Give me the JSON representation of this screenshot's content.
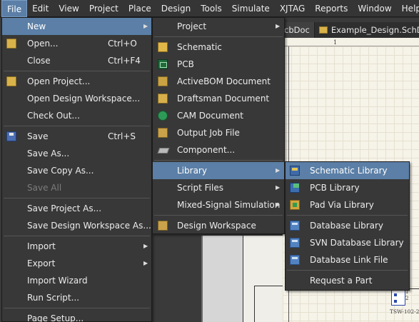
{
  "menubar": {
    "items": [
      {
        "label": "File",
        "underline": "F"
      },
      {
        "label": "Edit",
        "underline": "E"
      },
      {
        "label": "View",
        "underline": "V"
      },
      {
        "label": "Project",
        "underline": "c"
      },
      {
        "label": "Place",
        "underline": "P"
      },
      {
        "label": "Design",
        "underline": "D"
      },
      {
        "label": "Tools",
        "underline": "T"
      },
      {
        "label": "Simulate",
        "underline": "S"
      },
      {
        "label": "XJTAG",
        "underline": "J"
      },
      {
        "label": "Reports",
        "underline": "R"
      },
      {
        "label": "Window",
        "underline": "W"
      },
      {
        "label": "Help",
        "underline": "H"
      }
    ],
    "active": "File"
  },
  "doc_tabs": [
    {
      "label": "cbDoc"
    },
    {
      "label": "Example_Design.SchDoc"
    }
  ],
  "schematic": {
    "ruler_label": "1",
    "component_pins": [
      "1",
      "2"
    ],
    "component_label": "TSW-102-2"
  },
  "file_menu": {
    "items": [
      {
        "label": "New",
        "has_submenu": true,
        "highlighted": true
      },
      {
        "label": "Open...",
        "shortcut": "Ctrl+O",
        "icon": "open-folder-icon"
      },
      {
        "label": "Close",
        "shortcut": "Ctrl+F4"
      },
      {
        "label": "Open Project...",
        "icon": "open-project-icon"
      },
      {
        "label": "Open Design Workspace..."
      },
      {
        "label": "Check Out..."
      },
      {
        "label": "Save",
        "shortcut": "Ctrl+S",
        "icon": "save-icon"
      },
      {
        "label": "Save As..."
      },
      {
        "label": "Save Copy As..."
      },
      {
        "label": "Save All",
        "disabled": true
      },
      {
        "label": "Save Project As..."
      },
      {
        "label": "Save Design Workspace As..."
      },
      {
        "label": "Import",
        "has_submenu": true
      },
      {
        "label": "Export",
        "has_submenu": true
      },
      {
        "label": "Import Wizard"
      },
      {
        "label": "Run Script..."
      },
      {
        "label": "Page Setup..."
      }
    ]
  },
  "new_menu": {
    "items": [
      {
        "label": "Project",
        "has_submenu": true
      },
      {
        "label": "Schematic",
        "icon": "schematic-icon"
      },
      {
        "label": "PCB",
        "icon": "pcb-icon"
      },
      {
        "label": "ActiveBOM Document",
        "icon": "activebom-icon"
      },
      {
        "label": "Draftsman Document",
        "icon": "draftsman-icon"
      },
      {
        "label": "CAM Document",
        "icon": "cam-icon"
      },
      {
        "label": "Output Job File",
        "icon": "output-job-icon"
      },
      {
        "label": "Component...",
        "icon": "component-icon"
      },
      {
        "label": "Library",
        "has_submenu": true,
        "highlighted": true
      },
      {
        "label": "Script Files",
        "has_submenu": true
      },
      {
        "label": "Mixed-Signal Simulation",
        "has_submenu": true
      },
      {
        "label": "Design Workspace",
        "icon": "design-workspace-icon"
      }
    ]
  },
  "library_menu": {
    "items": [
      {
        "label": "Schematic Library",
        "icon": "schematic-library-icon",
        "highlighted": true
      },
      {
        "label": "PCB Library",
        "icon": "pcb-library-icon"
      },
      {
        "label": "Pad Via Library",
        "icon": "pad-via-library-icon"
      },
      {
        "label": "Database Library",
        "icon": "database-library-icon"
      },
      {
        "label": "SVN Database Library",
        "icon": "svn-database-library-icon"
      },
      {
        "label": "Database Link File",
        "icon": "database-link-icon"
      },
      {
        "label": "Request a Part"
      }
    ]
  },
  "colors": {
    "highlight": "#5b7fa6",
    "menu_bg": "#383838",
    "menubar_bg": "#353535",
    "disabled_text": "#7c7c7c"
  }
}
